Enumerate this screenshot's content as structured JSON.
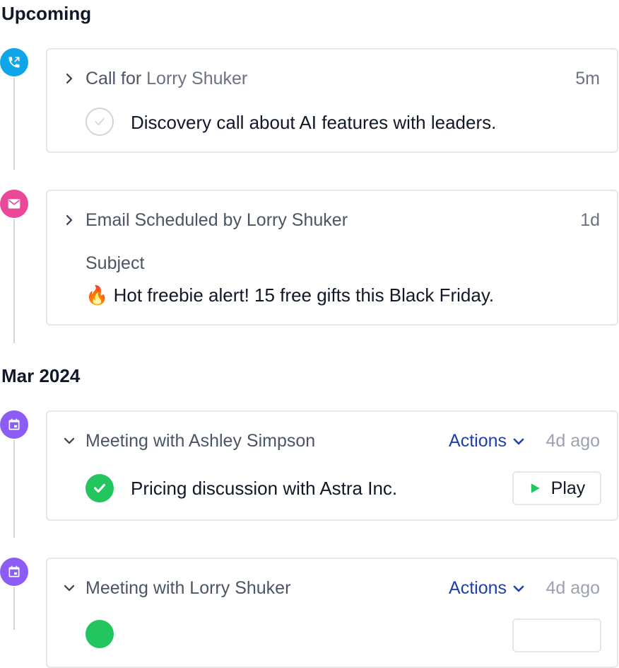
{
  "sections": {
    "upcoming": "Upcoming",
    "mar2024": "Mar 2024"
  },
  "colors": {
    "call": "#0ea5e9",
    "email": "#ec4899",
    "meeting": "#8b5cf6",
    "done": "#22c55e",
    "actions": "#1e40af"
  },
  "items": [
    {
      "type": "call",
      "icon": "phone-outgoing-icon",
      "title_prefix": "Call for",
      "title_name": "Lorry Shuker",
      "time": "5m",
      "body": "Discovery call about AI features with leaders.",
      "status": "incomplete"
    },
    {
      "type": "email",
      "icon": "mail-icon",
      "title": "Email Scheduled by Lorry Shuker",
      "time": "1d",
      "subject_label": "Subject",
      "subject_emoji": "🔥",
      "subject": "Hot freebie alert! 15 free gifts this Black Friday."
    },
    {
      "type": "meeting",
      "icon": "calendar-icon",
      "title": "Meeting with Ashley Simpson",
      "actions_label": "Actions",
      "time": "4d ago",
      "body": "Pricing discussion with Astra Inc.",
      "status": "complete",
      "play_label": "Play"
    },
    {
      "type": "meeting",
      "icon": "calendar-icon",
      "title": "Meeting with Lorry Shuker",
      "actions_label": "Actions",
      "time": "4d ago"
    }
  ]
}
